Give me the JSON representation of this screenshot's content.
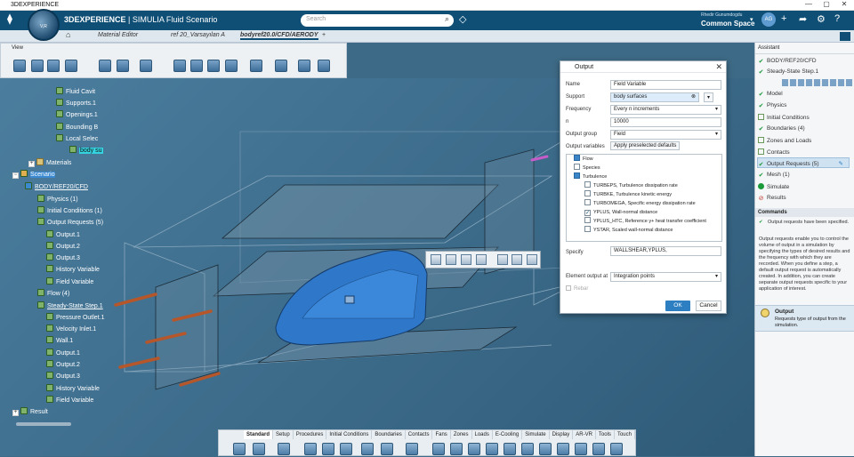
{
  "window": {
    "title": "3DEXPERIENCE",
    "controls": [
      "—",
      "▢",
      "✕"
    ]
  },
  "header": {
    "brand_bold": "3DEXPERIENCE",
    "brand_rest": " | SIMULIA Fluid Scenario",
    "compass_text": "V,R",
    "search_placeholder": "Search",
    "user_name": "Rhedir Gunumdogdu",
    "space": "Common Space",
    "avatar_initials": "AG"
  },
  "tabs": [
    {
      "label": "Material Editor"
    },
    {
      "label": "ref 20_Varsayılan A"
    },
    {
      "label": "bodyref20.0/CFD/AERODY"
    },
    {
      "label": "+"
    }
  ],
  "toolbar": {
    "label": "View"
  },
  "tree": [
    {
      "label": "Fluid Cavit"
    },
    {
      "label": "Supports.1"
    },
    {
      "label": "Openings.1"
    },
    {
      "label": "Bounding B"
    },
    {
      "label": "Local Selec"
    },
    {
      "label": "body su"
    },
    {
      "label": "Materials"
    },
    {
      "label": "Scenario"
    },
    {
      "label": "BODY/REF20/CFD"
    },
    {
      "label": "Physics (1)"
    },
    {
      "label": "Initial Conditions (1)"
    },
    {
      "label": "Output Requests (5)"
    },
    {
      "label": "Output.1"
    },
    {
      "label": "Output.2"
    },
    {
      "label": "Output.3"
    },
    {
      "label": "History Variable"
    },
    {
      "label": "Field Variable"
    },
    {
      "label": "Flow (4)"
    },
    {
      "label": "Steady-State Step.1"
    },
    {
      "label": "Pressure Outlet.1"
    },
    {
      "label": "Velocity Inlet.1"
    },
    {
      "label": "Wall.1"
    },
    {
      "label": "Output.1"
    },
    {
      "label": "Output.2"
    },
    {
      "label": "Output.3"
    },
    {
      "label": "History Variable"
    },
    {
      "label": "Field Variable"
    },
    {
      "label": "Result"
    }
  ],
  "dialog": {
    "title": "Output",
    "close": "✕",
    "name_label": "Name",
    "name_value": "Field Variable",
    "support_label": "Support",
    "support_value": "body surfaces",
    "frequency_label": "Frequency",
    "frequency_value": "Every n increments",
    "n_label": "n",
    "n_value": "10000",
    "group_label": "Output group",
    "group_value": "Field",
    "vars_label": "Output variables",
    "vars_button": "Apply preselected defaults",
    "variables": [
      {
        "label": "Flow",
        "checked": false,
        "category": true
      },
      {
        "label": "Species",
        "checked": false,
        "category": false
      },
      {
        "label": "Turbulence",
        "checked": false,
        "category": true
      },
      {
        "label": "TURBEPS, Turbulence dissipation rate",
        "checked": false,
        "category": false
      },
      {
        "label": "TURBKE, Turbulence kinetic energy",
        "checked": false,
        "category": false
      },
      {
        "label": "TURBOMEGA, Specific energy dissipation rate",
        "checked": false,
        "category": false
      },
      {
        "label": "YPLUS, Wall-normal distance",
        "checked": true,
        "category": false
      },
      {
        "label": "YPLUS_HTC, Reference y+ heat transfer coefficient",
        "checked": false,
        "category": false
      },
      {
        "label": "YSTAR, Scaled wall-normal distance",
        "checked": false,
        "category": false
      }
    ],
    "specify_label": "Specify",
    "specify_value": "WALLSHEAR,YPLUS,",
    "element_label": "Element output at",
    "element_value": "Integration points",
    "rebar_label": "Rebar",
    "ok": "OK",
    "cancel": "Cancel"
  },
  "assistant": {
    "title": "Assistant",
    "items": [
      {
        "label": "BODY/REF20/CFD"
      },
      {
        "label": "Steady-State Step.1"
      },
      {
        "label": "Model"
      },
      {
        "label": "Physics"
      },
      {
        "label": "Initial Conditions"
      },
      {
        "label": "Boundaries (4)"
      },
      {
        "label": "Zones and Loads"
      },
      {
        "label": "Contacts"
      },
      {
        "label": "Output Requests (5)"
      },
      {
        "label": "Mesh (1)"
      },
      {
        "label": "Simulate"
      },
      {
        "label": "Results"
      }
    ],
    "commands_title": "Commands",
    "cmd_status": "Output requests have been specified.",
    "cmd_help": "Output requests enable you to control the volume of output in a simulation by specifying the types of desired results and the frequency with which they are recorded. When you define a step, a default output request is automatically created. In addition, you can create separate output requests specific to your application of interest.",
    "output_title": "Output",
    "output_desc": "Requests type of output from the simulation."
  },
  "bottom_tabs": [
    "Standard",
    "Setup",
    "Procedures",
    "Initial Conditions",
    "Boundaries",
    "Contacts",
    "Fans",
    "Zones",
    "Loads",
    "E-Cooling",
    "Simulate",
    "Display",
    "AR-VR",
    "Tools",
    "Touch"
  ]
}
